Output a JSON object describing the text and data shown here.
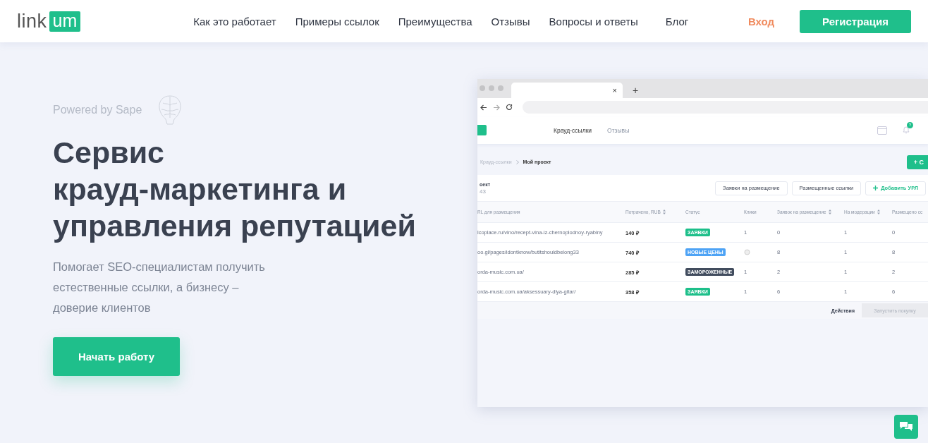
{
  "header": {
    "logo": {
      "word": "link",
      "badge": "um"
    },
    "nav": [
      {
        "label": "Как это работает"
      },
      {
        "label": "Примеры ссылок"
      },
      {
        "label": "Преимущества"
      },
      {
        "label": "Отзывы"
      },
      {
        "label": "Вопросы и ответы"
      },
      {
        "label": "Блог"
      }
    ],
    "login": "Вход",
    "register": "Регистрация"
  },
  "hero": {
    "powered": "Powered by Sape",
    "title": "Сервис\nкрауд-маркетинга и\nуправления репутацией",
    "subtitle": "Помогает SEO-специалистам получить\nестественные ссылки, а бизнесу –\nдоверие клиентов",
    "cta": "Начать работу"
  },
  "mockup": {
    "tab_close": "×",
    "new_tab": "+",
    "app_nav": [
      {
        "label": "Крауд-ссылки",
        "selected": true
      },
      {
        "label": "Отзывы",
        "selected": false
      }
    ],
    "notification_badge": "?",
    "breadcrumb": [
      "Крауд-ссылки",
      "Мой проект"
    ],
    "add_button": "+ С",
    "project": {
      "title": "оект",
      "subtitle": "43"
    },
    "actions": [
      {
        "label": "Заявки на размещение",
        "kind": "plain"
      },
      {
        "label": "Размещенные ссылки",
        "kind": "plain"
      },
      {
        "label": "Добавить УРЛ",
        "kind": "add"
      }
    ],
    "columns": [
      {
        "label": "RL для размещения",
        "sortable": false
      },
      {
        "label": "Потрачено, RUB",
        "sortable": true
      },
      {
        "label": "Статус",
        "sortable": false
      },
      {
        "label": "Клики",
        "sortable": false
      },
      {
        "label": "Заявок на размещение",
        "sortable": true
      },
      {
        "label": "На модерации",
        "sortable": true
      },
      {
        "label": "Размещено сс",
        "sortable": false
      }
    ],
    "rows": [
      {
        "url": "lcoplace.ru/vino/recept-vina-iz-chernoplodnoy-ryabiny",
        "spent": "140 ₽",
        "status": "ЗАЯВКИ",
        "color": "#1dbf8a",
        "clicks": "1",
        "clicks_loading": false,
        "requests": "0",
        "moderation": "1",
        "placed": "0"
      },
      {
        "url": "oo.gl/pages/idontknow/butitshouldbelong33",
        "spent": "740 ₽",
        "status": "НОВЫЕ ЦЕНЫ",
        "color": "#4ea3f5",
        "clicks": "",
        "clicks_loading": true,
        "requests": "8",
        "moderation": "1",
        "placed": "8"
      },
      {
        "url": "orda-music.com.ua/",
        "spent": "285 ₽",
        "status": "ЗАМОРОЖЕННЫЕ",
        "color": "#414c5e",
        "clicks": "1",
        "clicks_loading": false,
        "requests": "2",
        "moderation": "1",
        "placed": "2"
      },
      {
        "url": "orda-music.com.ua/aksessuary-dlya-gitar/",
        "spent": "358 ₽",
        "status": "ЗАЯВКИ",
        "color": "#1dbf8a",
        "clicks": "1",
        "clicks_loading": false,
        "requests": "6",
        "moderation": "1",
        "placed": "6"
      }
    ],
    "footer": {
      "actions_label": "Действия",
      "launch": "Запустить покупку"
    }
  }
}
